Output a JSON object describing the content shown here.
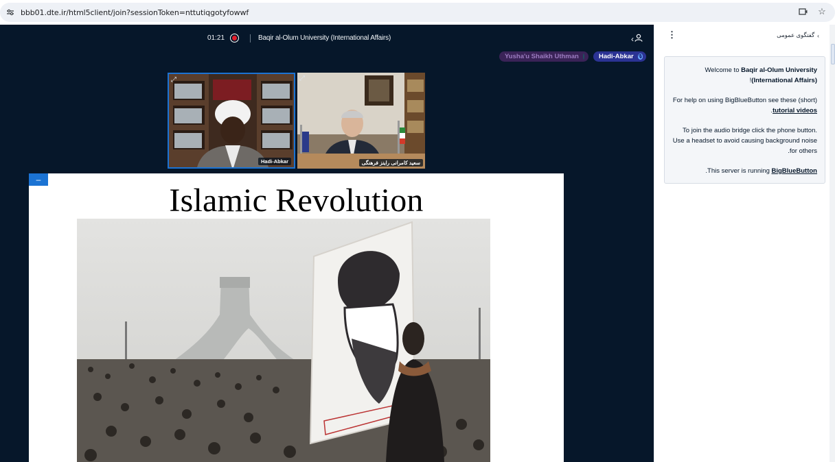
{
  "browser": {
    "url": "bbb01.dte.ir/html5client/join?sessionToken=nttutiqgotyfowwf",
    "site_info_icon": "tune-icon",
    "right_icons": [
      "cast-icon",
      "star-icon"
    ]
  },
  "nav": {
    "timer": "01:21",
    "meeting_title": "Baqir al-Olum University (International Affairs)",
    "users_toggle_icon": "user-icon"
  },
  "talkers": [
    {
      "name": "Yusha'u Shaikh Uthman"
    },
    {
      "name": "Hadi-Abkar"
    }
  ],
  "videos": [
    {
      "name": "Hadi-Abkar"
    },
    {
      "name": "سعید کامرانی راینز فرهنگی"
    }
  ],
  "presentation": {
    "minimize_label": "–",
    "slide_title": "Islamic Revolution"
  },
  "chat": {
    "title": "گفتگوی عمومی",
    "welcome": {
      "line1_pre": "Welcome to ",
      "line1_bold": "Baqir al-Olum University (International Affairs)",
      "line1_post": "!",
      "line2_pre": "For help on using BigBlueButton see these (short) ",
      "line2_link": "tutorial videos",
      "line2_post": ".",
      "line3": "To join the audio bridge click the phone button. Use a headset to avoid causing background noise for others.",
      "line4_pre": "This server is running ",
      "line4_link": "BigBlueButton",
      "line4_post": "."
    }
  },
  "colors": {
    "meeting_bg": "#06172a",
    "accent": "#1b73d3",
    "recording": "#e41e2b",
    "talker_inactive_bg": "#3a2357",
    "talker_active_bg": "#2b3394"
  }
}
